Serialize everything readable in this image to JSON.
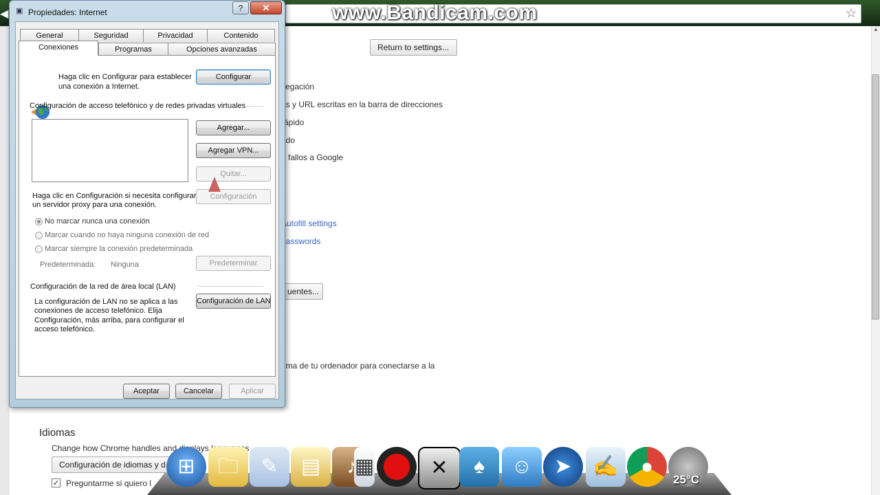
{
  "watermark": "www.Bandicam.com",
  "settings": {
    "return_button": "Return to settings...",
    "lines": [
      "vegación",
      "as y URL escritas en la barra de direcciones",
      "rápido",
      "ado",
      "e fallos a Google"
    ],
    "links": [
      "Autofill settings",
      "passwords"
    ],
    "partial_button": "uentes...",
    "network_text": "ema de tu ordenador para conectarse a la",
    "languages_title": "Idiomas",
    "languages_desc": "Change how Chrome handles and displays languages",
    "languages_button": "Configuración de idiomas y d",
    "ask_translate": "Preguntarme si quiero l"
  },
  "dialog": {
    "title": "Propiedades: Internet",
    "help_label": "?",
    "close_label": "✕",
    "tabs_row1": [
      "General",
      "Seguridad",
      "Privacidad",
      "Contenido"
    ],
    "tabs_row2": [
      "Conexiones",
      "Programas",
      "Opciones avanzadas"
    ],
    "intro_text_1": "Haga clic en Configurar para establecer",
    "intro_text_2": "una conexión a Internet.",
    "configure_button": "Configurar",
    "dialup_heading": "Configuración de acceso telefónico y de redes privadas virtuales",
    "add_button": "Agregar...",
    "add_vpn_button": "Agregar VPN...",
    "remove_button": "Quitar...",
    "settings_button": "Configuración",
    "proxy_text_1": "Haga clic en Configuración si necesita configurar",
    "proxy_text_2": "un servidor proxy para una conexión.",
    "radio_options": [
      "No marcar nunca una conexión",
      "Marcar cuando no haya ninguna conexión de red",
      "Marcar siempre la conexión predeterminada"
    ],
    "default_label": "Predeterminada:",
    "default_value": "Ninguna",
    "set_default_button": "Predeterminar",
    "lan_heading": "Configuración de la red de área local (LAN)",
    "lan_text": [
      "La configuración de LAN no se aplica a las",
      "conexiones de acceso telefónico. Elija",
      "Configuración, más arriba, para configurar el",
      "acceso telefónico."
    ],
    "lan_button": "Configuración de LAN",
    "ok_button": "Aceptar",
    "cancel_button": "Cancelar",
    "apply_button": "Aplicar"
  },
  "dock": {
    "temperature": "25°C",
    "icons": [
      "windows-start",
      "folder",
      "paint",
      "files",
      "violin",
      "media-player",
      "record",
      "xfire",
      "puzzle",
      "messenger",
      "cursor",
      "notepad",
      "chrome",
      "weather"
    ]
  }
}
